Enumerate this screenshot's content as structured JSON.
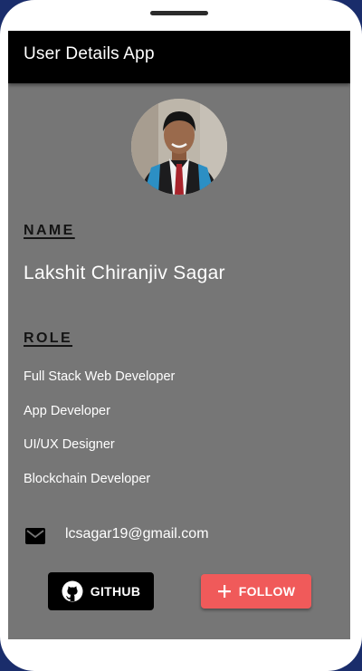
{
  "app": {
    "title": "User Details App"
  },
  "profile": {
    "name_heading": "NAME",
    "name": "Lakshit Chiranjiv Sagar",
    "role_heading": "ROLE",
    "roles": [
      "Full Stack Web Developer",
      "App Developer",
      "UI/UX Designer",
      "Blockchain Developer"
    ],
    "email": "lcsagar19@gmail.com"
  },
  "actions": {
    "github_label": "GITHUB",
    "follow_label": "FOLLOW"
  },
  "icons": {
    "email": "mail-icon",
    "github": "github-icon",
    "follow": "plus-icon"
  },
  "colors": {
    "appbar": "#000000",
    "screen_bg": "#767676",
    "follow_button": "#f05a5a",
    "github_button": "#000000"
  }
}
